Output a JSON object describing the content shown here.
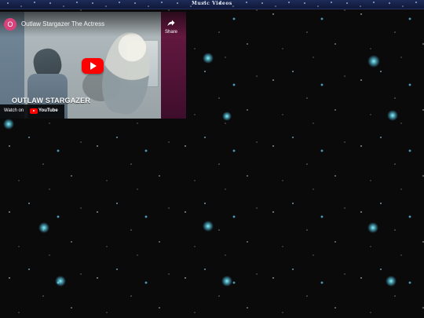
{
  "header": {
    "title": "Music Videos"
  },
  "video": {
    "channel_initial": "O",
    "title": "Outlaw Stargazer The Actress",
    "share_label": "Share",
    "overlay_text": "OUTLAW STARGAZER",
    "watch_on_label": "Watch on",
    "platform_name": "YouTube",
    "icons": {
      "share": "share-icon",
      "play": "play-icon",
      "platform": "youtube-logo-icon"
    }
  },
  "colors": {
    "background": "#0a0a0b",
    "header_navy": "#10183a",
    "youtube_red": "#ff0000",
    "star_cyan": "#78dcff",
    "avatar_pink": "#d9437c"
  }
}
